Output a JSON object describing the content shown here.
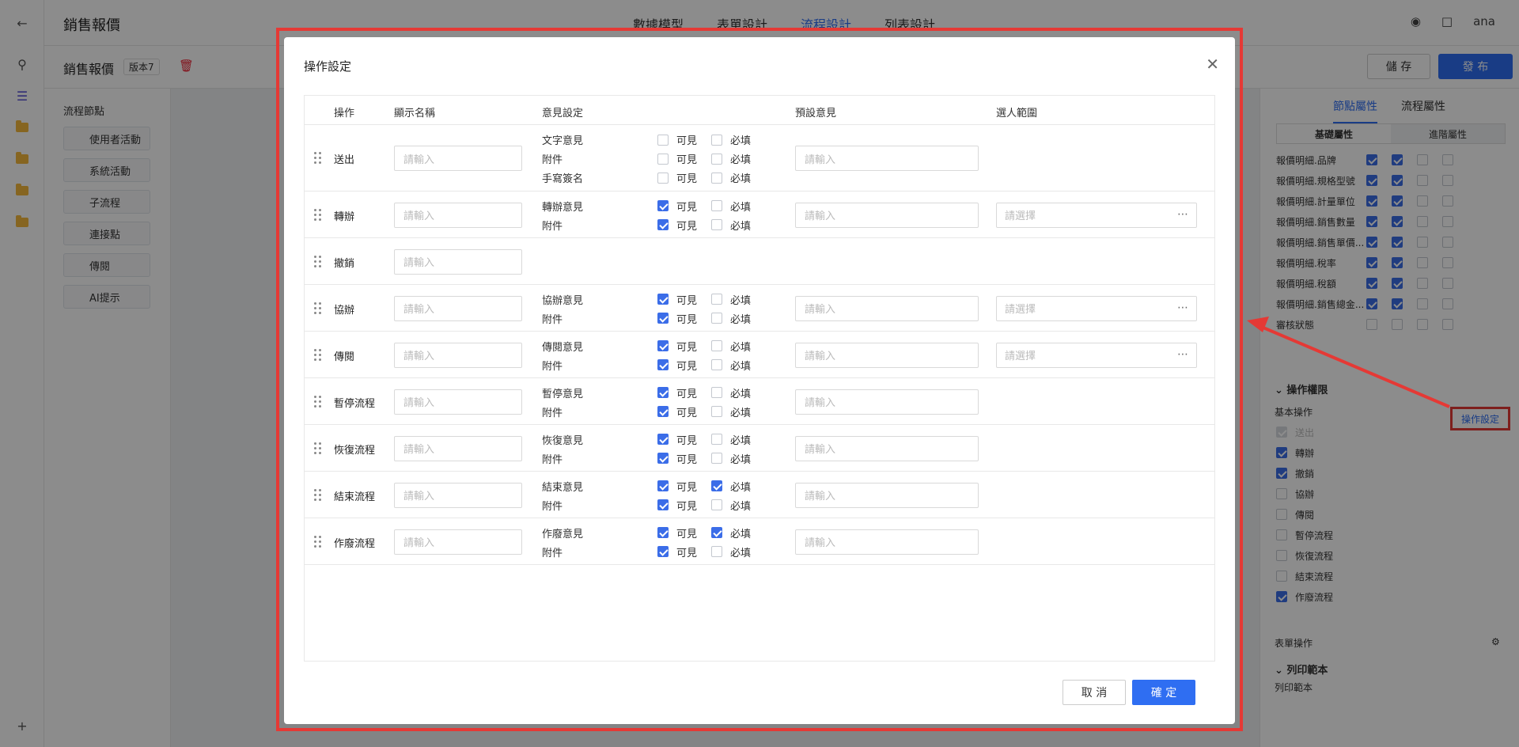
{
  "header": {
    "title": "銷售報價",
    "tabs": [
      "數據模型",
      "表單設計",
      "流程設計",
      "列表設計"
    ],
    "active_tab": "流程設計",
    "user": "ana"
  },
  "subbar": {
    "name": "銷售報價",
    "version": "版本7",
    "save": "儲 存",
    "publish": "發 布"
  },
  "left_panel": {
    "title": "流程節點",
    "nodes": [
      "使用者活動",
      "系統活動",
      "子流程",
      "連接點",
      "傳閱",
      "AI提示"
    ]
  },
  "right_panel": {
    "tabs": [
      "節點屬性",
      "流程屬性"
    ],
    "subtabs": [
      "基礎屬性",
      "進階屬性"
    ],
    "fields": [
      {
        "label": "報價明細.品牌",
        "checks": [
          true,
          true,
          false,
          false
        ]
      },
      {
        "label": "報價明細.規格型號",
        "checks": [
          true,
          true,
          false,
          false
        ]
      },
      {
        "label": "報價明細.計量單位",
        "checks": [
          true,
          true,
          false,
          false
        ]
      },
      {
        "label": "報價明細.銷售數量",
        "checks": [
          true,
          true,
          false,
          false
        ]
      },
      {
        "label": "報價明細.銷售單價...",
        "checks": [
          true,
          true,
          false,
          false
        ]
      },
      {
        "label": "報價明細.稅率",
        "checks": [
          true,
          true,
          false,
          false
        ]
      },
      {
        "label": "報價明細.稅額",
        "checks": [
          true,
          true,
          false,
          false
        ]
      },
      {
        "label": "報價明細.銷售總金...",
        "checks": [
          true,
          true,
          false,
          false
        ]
      },
      {
        "label": "審核狀態",
        "checks": [
          false,
          false,
          false,
          false
        ]
      }
    ],
    "op_section": "操作權限",
    "basic_ops_label": "基本操作",
    "op_setting_link": "操作設定",
    "ops": [
      {
        "label": "送出",
        "checked": true,
        "disabled": true
      },
      {
        "label": "轉辦",
        "checked": true,
        "disabled": false
      },
      {
        "label": "撤銷",
        "checked": true,
        "disabled": false
      },
      {
        "label": "協辦",
        "checked": false,
        "disabled": false
      },
      {
        "label": "傳閱",
        "checked": false,
        "disabled": false
      },
      {
        "label": "暫停流程",
        "checked": false,
        "disabled": false
      },
      {
        "label": "恢復流程",
        "checked": false,
        "disabled": false
      },
      {
        "label": "結束流程",
        "checked": false,
        "disabled": false
      },
      {
        "label": "作廢流程",
        "checked": true,
        "disabled": false
      }
    ],
    "form_ops": "表單操作",
    "print_section": "列印範本",
    "print_label": "列印範本"
  },
  "modal": {
    "title": "操作設定",
    "columns": [
      "操作",
      "顯示名稱",
      "意見設定",
      "預設意見",
      "選人範圍"
    ],
    "placeholder": "請輸入",
    "select_placeholder": "請選擇",
    "visible_label": "可見",
    "required_label": "必填",
    "cancel": "取 消",
    "ok": "確 定",
    "rows": [
      {
        "name": "送出",
        "opinions": [
          {
            "label": "文字意見",
            "visible": false,
            "required": false
          },
          {
            "label": "附件",
            "visible": false,
            "required": false
          },
          {
            "label": "手寫簽名",
            "visible": false,
            "required": false
          }
        ],
        "range": false
      },
      {
        "name": "轉辦",
        "opinions": [
          {
            "label": "轉辦意見",
            "visible": true,
            "required": false
          },
          {
            "label": "附件",
            "visible": true,
            "required": false
          }
        ],
        "range": true
      },
      {
        "name": "撤銷",
        "opinions": [],
        "range": false
      },
      {
        "name": "協辦",
        "opinions": [
          {
            "label": "協辦意見",
            "visible": true,
            "required": false
          },
          {
            "label": "附件",
            "visible": true,
            "required": false
          }
        ],
        "range": true
      },
      {
        "name": "傳閱",
        "opinions": [
          {
            "label": "傳閱意見",
            "visible": true,
            "required": false
          },
          {
            "label": "附件",
            "visible": true,
            "required": false
          }
        ],
        "range": true
      },
      {
        "name": "暫停流程",
        "opinions": [
          {
            "label": "暫停意見",
            "visible": true,
            "required": false
          },
          {
            "label": "附件",
            "visible": true,
            "required": false
          }
        ],
        "range": false
      },
      {
        "name": "恢復流程",
        "opinions": [
          {
            "label": "恢復意見",
            "visible": true,
            "required": false
          },
          {
            "label": "附件",
            "visible": true,
            "required": false
          }
        ],
        "range": false
      },
      {
        "name": "結束流程",
        "opinions": [
          {
            "label": "結束意見",
            "visible": true,
            "required": true
          },
          {
            "label": "附件",
            "visible": true,
            "required": false
          }
        ],
        "range": false
      },
      {
        "name": "作廢流程",
        "opinions": [
          {
            "label": "作廢意見",
            "visible": true,
            "required": true
          },
          {
            "label": "附件",
            "visible": true,
            "required": false
          }
        ],
        "range": false
      }
    ]
  },
  "colors": {
    "accent": "#2f6ef2",
    "highlight": "#e53935"
  }
}
